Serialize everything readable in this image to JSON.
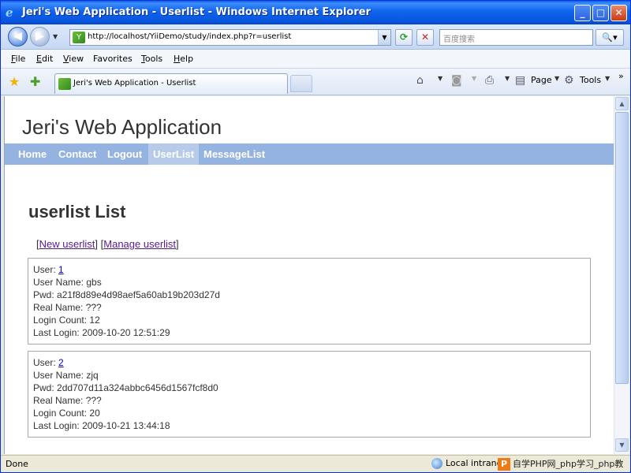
{
  "window": {
    "title": "Jeri's Web Application - Userlist - Windows Internet Explorer",
    "app_icon": "e",
    "minimize": "_",
    "maximize": "□",
    "close": "✕"
  },
  "address_bar": {
    "url": "http://localhost/YiiDemo/study/index.php?r=userlist",
    "search_placeholder": "百度搜索"
  },
  "menu": {
    "items": [
      {
        "label_u": "F",
        "label_rest": "ile"
      },
      {
        "label_u": "E",
        "label_rest": "dit"
      },
      {
        "label_u": "V",
        "label_rest": "iew"
      },
      {
        "label_u": "",
        "label_rest": "Favorites",
        "label_full": "Favorites"
      },
      {
        "label_u": "T",
        "label_rest": "ools"
      },
      {
        "label_u": "H",
        "label_rest": "elp"
      }
    ]
  },
  "tabbar": {
    "active_tab": "Jeri's Web Application - Userlist",
    "page_label": "Page",
    "tools_label": "Tools",
    "more": "»"
  },
  "site": {
    "title": "Jeri's Web Application",
    "nav": [
      "Home",
      "Contact",
      "Logout",
      "UserList",
      "MessageList"
    ],
    "active_nav": "UserList"
  },
  "page": {
    "heading": "userlist List",
    "actions": {
      "new_label": "New userlist",
      "manage_label": "Manage userlist"
    },
    "records": [
      {
        "user_label": "User:",
        "user_id": "1",
        "username_label": "User Name:",
        "username": "gbs",
        "pwd_label": "Pwd:",
        "pwd": "a21f8d89e4d98aef5a60ab19b203d27d",
        "realname_label": "Real Name:",
        "realname": "???",
        "logincount_label": "Login Count:",
        "logincount": "12",
        "lastlogin_label": "Last Login:",
        "lastlogin": "2009-10-20 12:51:29"
      },
      {
        "user_label": "User:",
        "user_id": "2",
        "username_label": "User Name:",
        "username": "zjq",
        "pwd_label": "Pwd:",
        "pwd": "2dd707d11a324abbc6456d1567fcf8d0",
        "realname_label": "Real Name:",
        "realname": "???",
        "logincount_label": "Login Count:",
        "logincount": "20",
        "lastlogin_label": "Last Login:",
        "lastlogin": "2009-10-21 13:44:18"
      }
    ]
  },
  "status": {
    "text": "Done",
    "zone": "Local intranet",
    "watermark": "自学PHP网_php学习_php教"
  }
}
